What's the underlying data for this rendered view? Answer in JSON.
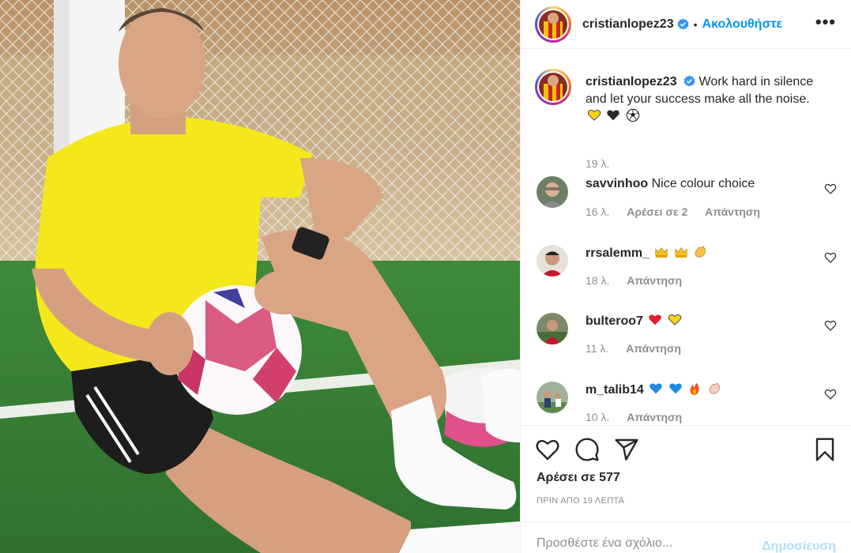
{
  "post": {
    "author": "cristianlopez23",
    "follow_label": "Ακολουθήστε",
    "more_label": "•••",
    "dot": "•"
  },
  "caption": {
    "username": "cristianlopez23",
    "text": "Work hard in silence and let your success make all the noise.",
    "emojis": [
      "yellow-heart",
      "black-heart",
      "soccer-ball"
    ],
    "time": "19 λ."
  },
  "comments": [
    {
      "username": "savvinhoo",
      "text": "Nice colour choice",
      "emojis": [],
      "time": "16 λ.",
      "likes": "Αρέσει σε 2",
      "reply": "Απάντηση"
    },
    {
      "username": "rrsalemm_",
      "text": "",
      "emojis": [
        "crown",
        "crown",
        "clap"
      ],
      "time": "18 λ.",
      "likes": "",
      "reply": "Απάντηση"
    },
    {
      "username": "bulteroo7",
      "text": "",
      "emojis": [
        "red-heart",
        "yellow-heart"
      ],
      "time": "11 λ.",
      "likes": "",
      "reply": "Απάντηση"
    },
    {
      "username": "m_talib14",
      "text": "",
      "emojis": [
        "blue-heart",
        "blue-heart",
        "fire",
        "clap"
      ],
      "time": "10 λ.",
      "likes": "",
      "reply": "Απάντηση"
    }
  ],
  "actions": {
    "like_icon": "heart-icon",
    "comment_icon": "comment-icon",
    "share_icon": "send-icon",
    "save_icon": "bookmark-icon",
    "likes_text": "Αρέσει σε 577",
    "post_time": "ΠΡΙΝ ΑΠΟ 19 ΛΕΠΤΑ"
  },
  "add_comment": {
    "placeholder": "Προσθέστε ένα σχόλιο...",
    "publish_label": "Δημοσίευση"
  },
  "colors": {
    "accent": "#0095f6",
    "publish_disabled": "#b2dffc",
    "muted": "#8e8e8e",
    "border": "#efefef"
  }
}
